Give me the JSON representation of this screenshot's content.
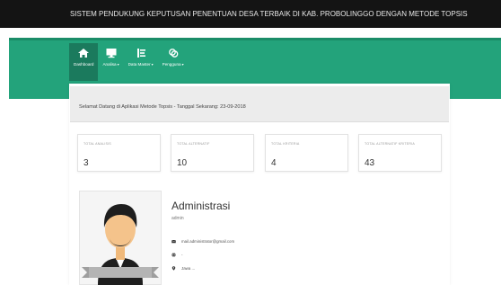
{
  "app": {
    "title": "SISTEM PENDUKUNG KEPUTUSAN PENENTUAN DESA TERBAIK DI KAB. PROBOLINGGO DENGAN METODE TOPSIS"
  },
  "nav": {
    "items": [
      {
        "label": "Dashboard",
        "icon": "home-icon",
        "active": true,
        "caret": ""
      },
      {
        "label": "Analisa",
        "icon": "monitor-icon",
        "active": false,
        "caret": "▾"
      },
      {
        "label": "Data Master",
        "icon": "list-icon",
        "active": false,
        "caret": "▾"
      },
      {
        "label": "Pengguna",
        "icon": "users-icon",
        "active": false,
        "caret": "▾"
      }
    ]
  },
  "welcome": {
    "text": "Selamat Datang di Aplikasi Metode Topsis - Tanggal Sekarang: 23-09-2018"
  },
  "stats": [
    {
      "label": "TOTAL ANALISIS",
      "value": "3"
    },
    {
      "label": "TOTAL ALTERNATIF",
      "value": "10"
    },
    {
      "label": "TOTAL KRITERIA",
      "value": "4"
    },
    {
      "label": "TOTAL ALTERNATIF KRITERIA",
      "value": "43"
    }
  ],
  "profile": {
    "name": "Administrasi",
    "role": "admin",
    "email": "mail.administrator@gmail.com",
    "website": "-",
    "location": "Jawa ..."
  },
  "colors": {
    "titlebar": "#141414",
    "nav_band": "#23a37b",
    "nav_active": "#1b7a5d"
  }
}
